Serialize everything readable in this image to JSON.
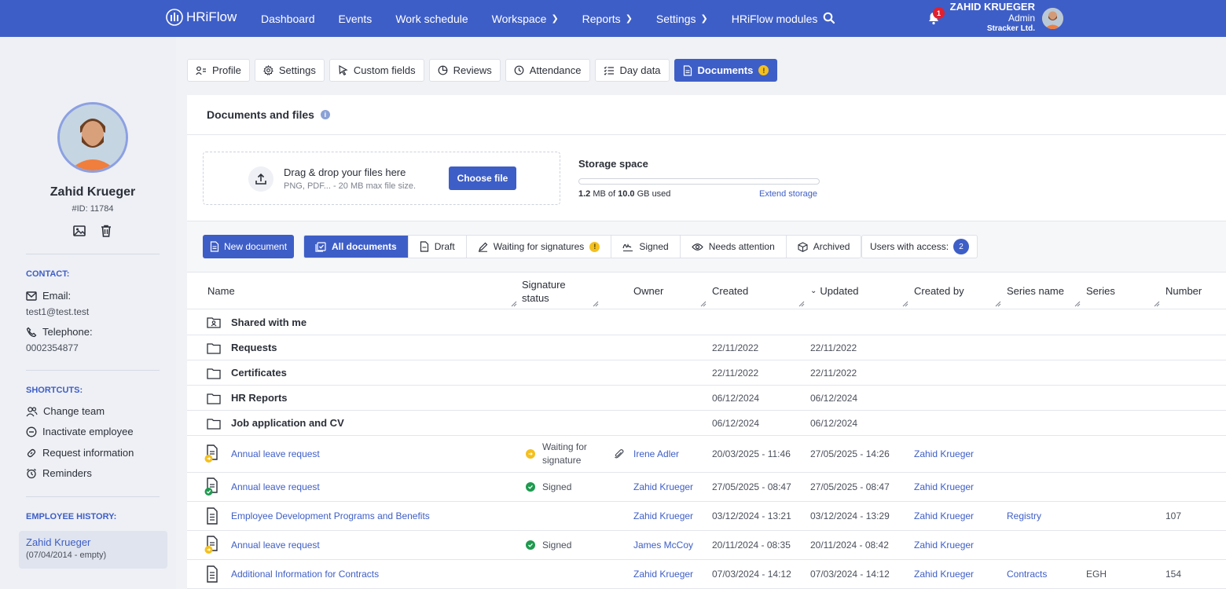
{
  "nav": {
    "brand": "HRiFlow",
    "items": [
      {
        "label": "Dashboard",
        "chevron": false
      },
      {
        "label": "Events",
        "chevron": false
      },
      {
        "label": "Work schedule",
        "chevron": false
      },
      {
        "label": "Workspace",
        "chevron": true
      },
      {
        "label": "Reports",
        "chevron": true
      },
      {
        "label": "Settings",
        "chevron": true
      },
      {
        "label": "HRiFlow modules",
        "chevron": false
      }
    ],
    "notification_count": "1",
    "user": {
      "name": "ZAHID KRUEGER",
      "role": "Admin",
      "company": "Stracker Ltd."
    }
  },
  "sidebar": {
    "name": "Zahid Krueger",
    "id": "#ID: 11784",
    "contact_title": "CONTACT:",
    "email_label": "Email:",
    "email": "test1@test.test",
    "phone_label": "Telephone:",
    "phone": "0002354877",
    "shortcuts_title": "SHORTCUTS:",
    "shortcuts": [
      "Change team",
      "Inactivate employee",
      "Request information",
      "Reminders"
    ],
    "history_title": "EMPLOYEE HISTORY:",
    "history": {
      "name": "Zahid Krueger",
      "dates": "(07/04/2014 - empty)"
    }
  },
  "tabs": [
    {
      "label": "Profile",
      "icon": "user-list-icon"
    },
    {
      "label": "Settings",
      "icon": "gear-icon"
    },
    {
      "label": "Custom fields",
      "icon": "cursor-icon"
    },
    {
      "label": "Reviews",
      "icon": "pie-icon"
    },
    {
      "label": "Attendance",
      "icon": "clock-icon"
    },
    {
      "label": "Day data",
      "icon": "checklist-icon"
    },
    {
      "label": "Documents",
      "icon": "document-icon",
      "active": true,
      "warning": "!"
    }
  ],
  "panel": {
    "title": "Documents and files",
    "upload": {
      "title": "Drag & drop your files here",
      "hint": "PNG, PDF... - 20 MB max file size.",
      "button": "Choose file"
    },
    "storage": {
      "title": "Storage space",
      "used_amount": "1.2",
      "used_unit": " MB of ",
      "total_amount": "10.0",
      "total_unit": " GB used",
      "used_fraction": 0.00012,
      "extend": "Extend storage"
    }
  },
  "toolbar": {
    "new_document": "New document",
    "filters": [
      {
        "label": "All documents",
        "icon": "doc-check-icon",
        "active": true
      },
      {
        "label": "Draft",
        "icon": "draft-icon"
      },
      {
        "label": "Waiting for signatures",
        "icon": "pen-icon",
        "warning": "!"
      },
      {
        "label": "Signed",
        "icon": "signature-icon"
      },
      {
        "label": "Needs attention",
        "icon": "eye-icon"
      },
      {
        "label": "Archived",
        "icon": "box-icon"
      }
    ],
    "access_label": "Users with access:",
    "access_count": "2"
  },
  "table": {
    "columns": {
      "name": "Name",
      "signature": "Signature status",
      "owner": "Owner",
      "created": "Created",
      "updated": "Updated",
      "created_by": "Created by",
      "series_name": "Series name",
      "series": "Series",
      "number": "Number"
    },
    "folders": [
      {
        "name": "Shared with me",
        "created": "",
        "updated": "",
        "shared": true
      },
      {
        "name": "Requests",
        "created": "22/11/2022",
        "updated": "22/11/2022"
      },
      {
        "name": "Certificates",
        "created": "22/11/2022",
        "updated": "22/11/2022"
      },
      {
        "name": "HR Reports",
        "created": "06/12/2024",
        "updated": "06/12/2024"
      },
      {
        "name": "Job application and CV",
        "created": "06/12/2024",
        "updated": "06/12/2024"
      }
    ],
    "documents": [
      {
        "name": "Annual leave request",
        "status": "Waiting for signature",
        "status_type": "waiting",
        "attachment": true,
        "owner": "Irene Adler",
        "created": "20/03/2025 - 11:46",
        "updated": "27/05/2025 - 14:26",
        "created_by": "Zahid Krueger",
        "series_name": "",
        "series": "",
        "number": "",
        "badge": "pending"
      },
      {
        "name": "Annual leave request",
        "status": "Signed",
        "status_type": "signed",
        "attachment": false,
        "owner": "Zahid Krueger",
        "created": "27/05/2025 - 08:47",
        "updated": "27/05/2025 - 08:47",
        "created_by": "Zahid Krueger",
        "series_name": "",
        "series": "",
        "number": "",
        "badge": "signed"
      },
      {
        "name": "Employee Development Programs and Benefits",
        "status": "",
        "status_type": "",
        "attachment": false,
        "owner": "Zahid Krueger",
        "created": "03/12/2024 - 13:21",
        "updated": "03/12/2024 - 13:29",
        "created_by": "Zahid Krueger",
        "series_name": "Registry",
        "series": "",
        "number": "107",
        "badge": ""
      },
      {
        "name": "Annual leave request",
        "status": "Signed",
        "status_type": "signed",
        "attachment": false,
        "owner": "James McCoy",
        "created": "20/11/2024 - 08:35",
        "updated": "20/11/2024 - 08:42",
        "created_by": "Zahid Krueger",
        "series_name": "",
        "series": "",
        "number": "",
        "badge": "pending"
      },
      {
        "name": "Additional Information for Contracts",
        "status": "",
        "status_type": "",
        "attachment": false,
        "owner": "Zahid Krueger",
        "created": "07/03/2024 - 14:12",
        "updated": "07/03/2024 - 14:12",
        "created_by": "Zahid Krueger",
        "series_name": "Contracts",
        "series": "EGH",
        "number": "154",
        "badge": ""
      }
    ]
  },
  "colors": {
    "primary": "#3e5ec7",
    "signed": "#1e9a4f",
    "warning": "#f4c01e",
    "alert": "#e0212f"
  }
}
